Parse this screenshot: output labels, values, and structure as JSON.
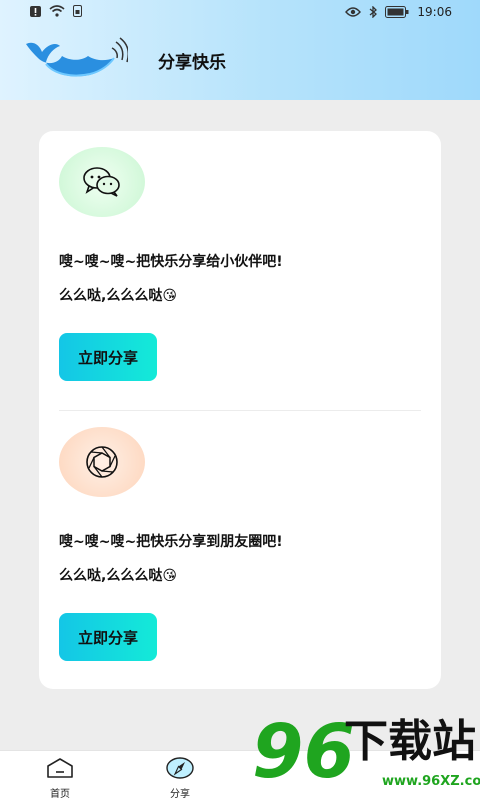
{
  "status_bar": {
    "time": "19:06"
  },
  "header": {
    "title": "分享快乐"
  },
  "shares": [
    {
      "icon": "wechat-chat-icon",
      "text": "嗖~嗖~嗖~把快乐分享给小伙伴吧!",
      "sub": "么么哒,么么么哒😘",
      "button": "立即分享"
    },
    {
      "icon": "moments-aperture-icon",
      "text": "嗖~嗖~嗖~把快乐分享到朋友圈吧!",
      "sub": "么么哒,么么么哒😘",
      "button": "立即分享"
    }
  ],
  "bottom_nav": {
    "items": [
      {
        "label": "首页",
        "icon": "home-icon"
      },
      {
        "label": "分享",
        "icon": "compass-icon"
      }
    ]
  },
  "watermark": {
    "number": "96",
    "text": "下载站",
    "url": "www.96XZ.com"
  },
  "colors": {
    "header_start": "#dff3ff",
    "header_end": "#9fd9fb",
    "button_start": "#14c6e6",
    "button_end": "#14ead8",
    "watermark_green": "#1fa51f"
  }
}
